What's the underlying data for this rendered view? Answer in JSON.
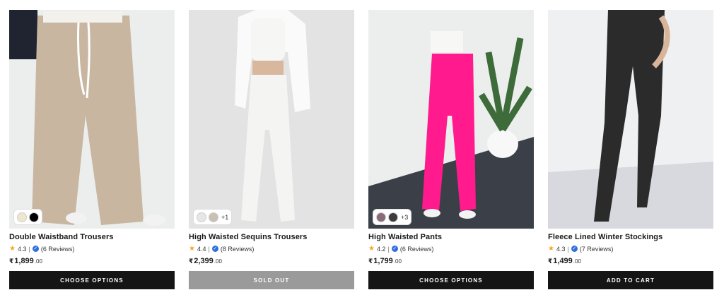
{
  "products": [
    {
      "title": "Double Waistband Trousers",
      "rating": "4.3",
      "reviews": "(6 Reviews)",
      "currency": "₹",
      "price": "1,899",
      "paise": ".00",
      "button": "CHOOSE OPTIONS",
      "swatches": [
        "#efe6cf",
        "#000000"
      ],
      "more": "",
      "colors": {
        "bg": "#eef0ee",
        "garment": "#c9b8a3",
        "accent": "#1f2430"
      }
    },
    {
      "title": "High Waisted Sequins Trousers",
      "rating": "4.4",
      "reviews": "(8 Reviews)",
      "currency": "₹",
      "price": "2,399",
      "paise": ".00",
      "button": "SOLD OUT",
      "swatches": [
        "#e6e6e6",
        "#cbbfb4"
      ],
      "more": "+1",
      "colors": {
        "bg": "#e4e4e4",
        "garment": "#f3f3f1",
        "accent": "#f7f7f7"
      }
    },
    {
      "title": "High Waisted Pants",
      "rating": "4.2",
      "reviews": "(6 Reviews)",
      "currency": "₹",
      "price": "1,799",
      "paise": ".00",
      "button": "CHOOSE OPTIONS",
      "swatches": [
        "#8a6b77",
        "#3c3c3c"
      ],
      "more": "+3",
      "colors": {
        "bg": "#eceeed",
        "garment": "#ff1b8d",
        "accent": "#3a3d44"
      }
    },
    {
      "title": "Fleece Lined Winter Stockings",
      "rating": "4.3",
      "reviews": "(7 Reviews)",
      "currency": "₹",
      "price": "1,499",
      "paise": ".00",
      "button": "ADD TO CART",
      "swatches": [],
      "more": "",
      "colors": {
        "bg": "#eff0f2",
        "garment": "#2a2a2a",
        "accent": "#cfd1d6"
      }
    }
  ],
  "theme": {
    "button_bg": "#151515",
    "button_disabled_bg": "#9a9a9a",
    "star": "#f5a623",
    "verified": "#2f6fde"
  }
}
